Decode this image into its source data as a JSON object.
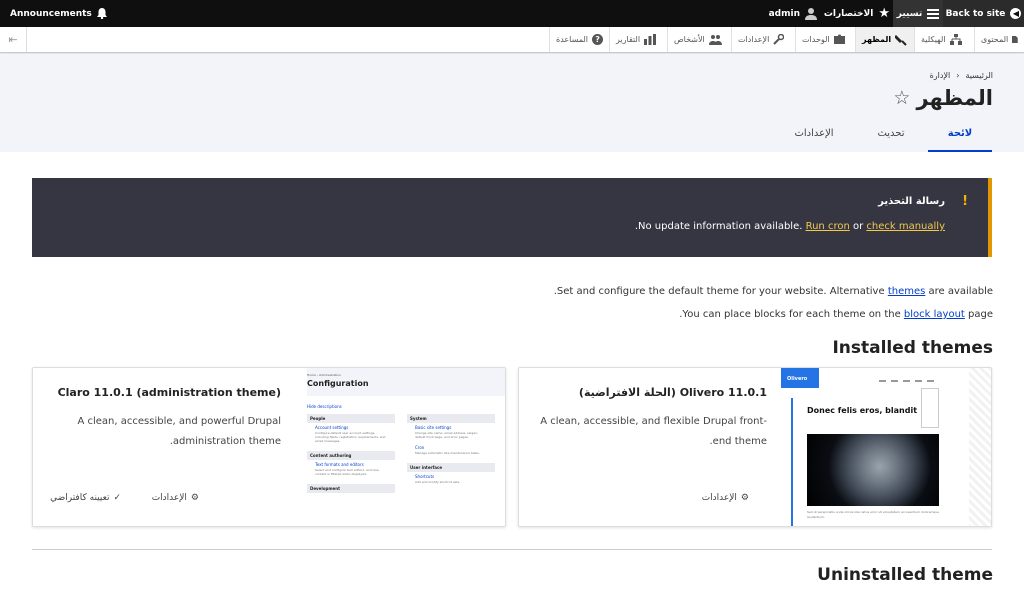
{
  "toolbar": {
    "back_label": "Back to site",
    "manage_label": "تسيير",
    "shortcuts_label": "الاختصارات",
    "user_label": "admin",
    "announcements_label": "Announcements"
  },
  "tray": {
    "items": [
      {
        "label": "المحتوى",
        "icon": "file-icon"
      },
      {
        "label": "الهيكلية",
        "icon": "structure-icon"
      },
      {
        "label": "المظهر",
        "icon": "paint-icon"
      },
      {
        "label": "الوحدات",
        "icon": "puzzle-icon"
      },
      {
        "label": "الإعدادات",
        "icon": "wrench-icon"
      },
      {
        "label": "الأشخاص",
        "icon": "people-icon"
      },
      {
        "label": "التقارير",
        "icon": "chart-icon"
      },
      {
        "label": "المساعدة",
        "icon": "help-icon"
      }
    ]
  },
  "breadcrumb": {
    "home": "الرئيسية",
    "admin": "الإدارة",
    "sep": "‹"
  },
  "page": {
    "title": "المظهر",
    "star": "☆"
  },
  "tabs": {
    "list": "لائحة",
    "update": "تحديث",
    "settings": "الإعدادات"
  },
  "warning": {
    "icon": "!",
    "title": "رسالة التحذير",
    "msg_pre": "No update information available. ",
    "run_cron": "Run cron",
    "or": " or ",
    "check_manually": "check manually",
    "msg_end": "."
  },
  "intro": {
    "line1_pre": "Set and configure the default theme for your website. Alternative ",
    "themes_link": "themes",
    "line1_post": " are available.",
    "line2_pre": "You can place blocks for each theme on the ",
    "block_layout_link": "block layout",
    "line2_post": " page."
  },
  "installed": {
    "heading": "Installed themes",
    "olivero": {
      "title": "Olivero 11.0.1 (الحلة الافتراضية)",
      "desc": "A clean, accessible, and flexible Drupal front-end theme.",
      "settings": "الإعدادات",
      "logo": "Olivero",
      "hero": "Donec felis eros, blandit",
      "body_text": "Sed ut perspiciatis unde omnis iste natus error sit voluptatem accusantium doloremque laudantium."
    },
    "claro": {
      "title": "Claro 11.0.1 (administration theme)",
      "desc": "A clean, accessible, and powerful Drupal administration theme.",
      "settings": "الإعدادات",
      "set_default": "تعيينه كافتراضي",
      "bc": "Home  ›  Administration",
      "heading": "Configuration",
      "hide": "Hide descriptions",
      "groups": [
        {
          "title": "People",
          "links": [
            {
              "name": "Account settings",
              "desc": "Configure default user account settings, including fields, registration requirements, and email messages."
            }
          ]
        },
        {
          "title": "Content authoring",
          "links": [
            {
              "name": "Text formats and editors",
              "desc": "Select and configure text editors, and how content is filtered when displayed."
            }
          ]
        },
        {
          "title": "Development",
          "links": []
        },
        {
          "title": "System",
          "links": [
            {
              "name": "Basic site settings",
              "desc": "Change site name, email address, slogan, default front page, and error pages."
            },
            {
              "name": "Cron",
              "desc": "Manage automatic site maintenance tasks."
            }
          ]
        },
        {
          "title": "User interface",
          "links": [
            {
              "name": "Shortcuts",
              "desc": "Add and modify shortcut sets."
            }
          ]
        }
      ]
    }
  },
  "uninstalled": {
    "heading": "Uninstalled theme"
  }
}
